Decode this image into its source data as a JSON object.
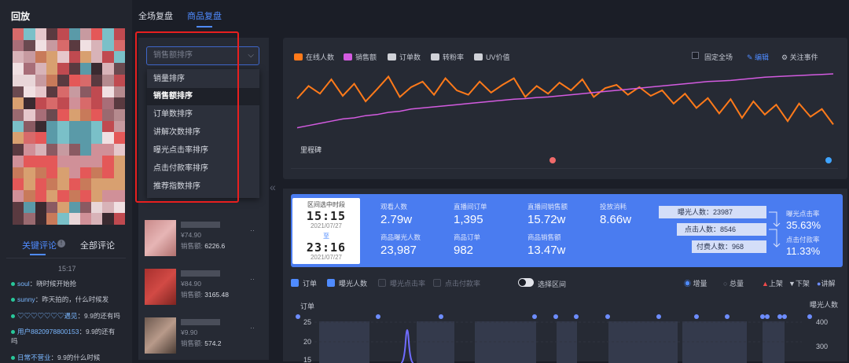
{
  "sidebar": {
    "title": "回放",
    "comment_tabs": [
      "关键评论",
      "全部评论"
    ],
    "comment_time": "15:17",
    "comments": [
      {
        "user": "soul",
        "text": "晓时候开始抢"
      },
      {
        "user": "sunny",
        "text": "昨天拍的，什么时候发"
      },
      {
        "user": "♡♡♡♡♡♡♡遇见",
        "text": "9.9的还有吗"
      },
      {
        "user": "用户8820978800153",
        "text": "9.9的还有吗"
      },
      {
        "user": "日常不营业",
        "text": "9.9的什么时候"
      }
    ]
  },
  "top_tabs": [
    "全场复盘",
    "商品复盘"
  ],
  "sort": {
    "placeholder": "销售额排序",
    "options": [
      "销量排序",
      "销售额排序",
      "订单数排序",
      "讲解次数排序",
      "曝光点击率排序",
      "点击付款率排序",
      "推荐指数排序"
    ],
    "selected": "销售额排序"
  },
  "products": [
    {
      "price": "¥74.90",
      "sales_label": "销售额:",
      "sales": "6226.6",
      "more": "··"
    },
    {
      "price": "¥84.90",
      "sales_label": "销售额:",
      "sales": "3165.48",
      "more": "··"
    },
    {
      "price": "¥9.90",
      "sales_label": "销售额:",
      "sales": "574.2",
      "more": "··"
    }
  ],
  "trend_chart": {
    "legend": [
      {
        "label": "在线人数",
        "color": "#ff7a1a"
      },
      {
        "label": "销售额",
        "color": "#d35be0"
      },
      {
        "label": "订单数",
        "color": "#d0d2d8"
      },
      {
        "label": "转粉率",
        "color": "#d0d2d8"
      },
      {
        "label": "UV价值",
        "color": "#d0d2d8"
      }
    ],
    "fixed_label": "固定全场",
    "edit_label": "编辑",
    "event_label": "关注事件",
    "milestone_label": "里程碑"
  },
  "chart_data": {
    "type": "line",
    "series": [
      {
        "name": "在线人数",
        "values": [
          0.55,
          0.78,
          0.64,
          0.9,
          0.6,
          0.82,
          0.5,
          0.72,
          0.95,
          0.58,
          0.76,
          0.86,
          0.62,
          0.92,
          0.7,
          0.62,
          0.86,
          0.66,
          0.8,
          0.92,
          0.58,
          0.78,
          0.64,
          0.84,
          0.7,
          0.9,
          0.58,
          0.74,
          0.8,
          0.62,
          0.76,
          0.6,
          0.7,
          0.46,
          0.64,
          0.38,
          0.56,
          0.28,
          0.54,
          0.2,
          0.5,
          0.26,
          0.44,
          0.14,
          0.46,
          0.22,
          0.36,
          0.08
        ]
      },
      {
        "name": "销售额",
        "values": [
          0.02,
          0.06,
          0.1,
          0.14,
          0.18,
          0.2,
          0.24,
          0.26,
          0.3,
          0.32,
          0.36,
          0.38,
          0.4,
          0.42,
          0.44,
          0.46,
          0.48,
          0.5,
          0.52,
          0.54,
          0.55,
          0.57,
          0.58,
          0.6,
          0.62,
          0.64,
          0.66,
          0.68,
          0.7,
          0.72,
          0.74,
          0.76,
          0.78,
          0.8,
          0.82,
          0.84,
          0.86,
          0.87,
          0.88,
          0.9,
          0.92,
          0.94,
          0.95,
          0.96,
          0.97,
          0.98,
          0.99,
          1.0
        ]
      }
    ]
  },
  "time_card": {
    "label": "区间选中时段",
    "start": "15:15",
    "date1": "2021/07/27",
    "to": "至",
    "end": "23:16",
    "date2": "2021/07/27"
  },
  "stats": [
    {
      "label": "观看人数",
      "value": "2.79w"
    },
    {
      "label": "直播间订单",
      "value": "1,395"
    },
    {
      "label": "直播间销售额",
      "value": "15.72w"
    },
    {
      "label": "投放消耗",
      "value": "8.66w"
    },
    {
      "label": "商品曝光人数",
      "value": "23,987"
    },
    {
      "label": "商品订单",
      "value": "982"
    },
    {
      "label": "商品销售额",
      "value": "13.47w"
    }
  ],
  "funnel": [
    {
      "label": "曝光人数：",
      "value": "23987"
    },
    {
      "label": "点击人数：",
      "value": "8546"
    },
    {
      "label": "付费人数：",
      "value": "968"
    }
  ],
  "funnel_rates": [
    {
      "label": "曝光点击率",
      "value": "35.63%"
    },
    {
      "label": "点击付款率",
      "value": "11.33%"
    }
  ],
  "bottom_controls": {
    "checks": [
      {
        "label": "订单",
        "on": true
      },
      {
        "label": "曝光人数",
        "on": true
      },
      {
        "label": "曝光点击率",
        "on": false
      },
      {
        "label": "点击付款率",
        "on": false
      }
    ],
    "toggle_label": "选择区间",
    "radios": [
      "增量",
      "总量"
    ],
    "markers": [
      "上架",
      "下架",
      "讲解"
    ]
  },
  "bottom_chart": {
    "y_left_title": "订单",
    "y_right_title": "曝光人数",
    "y_left_ticks": [
      "25",
      "20",
      "15"
    ],
    "y_right_ticks": [
      "400",
      "300"
    ]
  }
}
